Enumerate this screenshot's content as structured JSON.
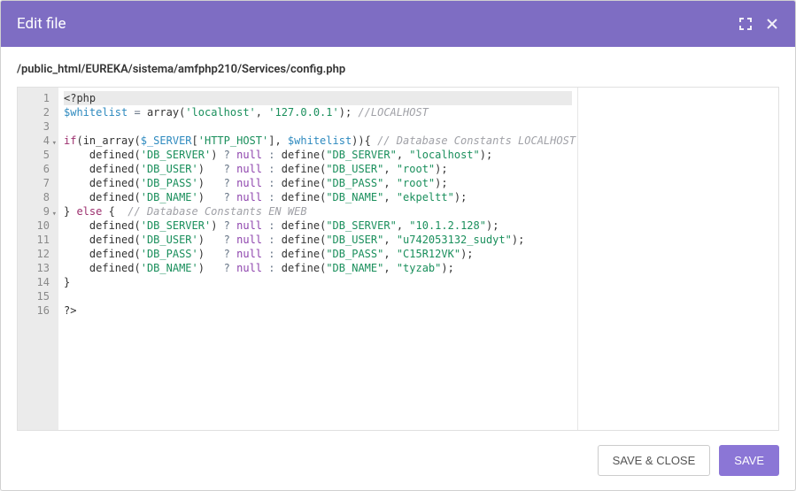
{
  "header": {
    "title": "Edit file"
  },
  "file": {
    "path": "/public_html/EUREKA/sistema/amfphp210/Services/config.php"
  },
  "code": {
    "lines": [
      [
        {
          "t": "tag",
          "v": "<?php"
        }
      ],
      [
        {
          "t": "var",
          "v": "$whitelist"
        },
        {
          "t": "txt",
          "v": " "
        },
        {
          "t": "op",
          "v": "="
        },
        {
          "t": "txt",
          "v": " "
        },
        {
          "t": "fn",
          "v": "array"
        },
        {
          "t": "txt",
          "v": "("
        },
        {
          "t": "str",
          "v": "'localhost'"
        },
        {
          "t": "txt",
          "v": ", "
        },
        {
          "t": "str",
          "v": "'127.0.0.1'"
        },
        {
          "t": "txt",
          "v": "); "
        },
        {
          "t": "cmt",
          "v": "//LOCALHOST"
        }
      ],
      [
        {
          "t": "txt",
          "v": ""
        }
      ],
      [
        {
          "t": "kw",
          "v": "if"
        },
        {
          "t": "txt",
          "v": "("
        },
        {
          "t": "fn",
          "v": "in_array"
        },
        {
          "t": "txt",
          "v": "("
        },
        {
          "t": "var",
          "v": "$_SERVER"
        },
        {
          "t": "txt",
          "v": "["
        },
        {
          "t": "str",
          "v": "'HTTP_HOST'"
        },
        {
          "t": "txt",
          "v": "], "
        },
        {
          "t": "var",
          "v": "$whitelist"
        },
        {
          "t": "txt",
          "v": ")){ "
        },
        {
          "t": "cmt",
          "v": "// Database Constants LOCALHOST"
        }
      ],
      [
        {
          "t": "txt",
          "v": "    "
        },
        {
          "t": "fn",
          "v": "defined"
        },
        {
          "t": "txt",
          "v": "("
        },
        {
          "t": "str",
          "v": "'DB_SERVER'"
        },
        {
          "t": "txt",
          "v": ") "
        },
        {
          "t": "op",
          "v": "?"
        },
        {
          "t": "txt",
          "v": " "
        },
        {
          "t": "null",
          "v": "null"
        },
        {
          "t": "txt",
          "v": " "
        },
        {
          "t": "op",
          "v": ":"
        },
        {
          "t": "txt",
          "v": " "
        },
        {
          "t": "fn",
          "v": "define"
        },
        {
          "t": "txt",
          "v": "("
        },
        {
          "t": "str",
          "v": "\"DB_SERVER\""
        },
        {
          "t": "txt",
          "v": ", "
        },
        {
          "t": "str",
          "v": "\"localhost\""
        },
        {
          "t": "txt",
          "v": ");"
        }
      ],
      [
        {
          "t": "txt",
          "v": "    "
        },
        {
          "t": "fn",
          "v": "defined"
        },
        {
          "t": "txt",
          "v": "("
        },
        {
          "t": "str",
          "v": "'DB_USER'"
        },
        {
          "t": "txt",
          "v": ")   "
        },
        {
          "t": "op",
          "v": "?"
        },
        {
          "t": "txt",
          "v": " "
        },
        {
          "t": "null",
          "v": "null"
        },
        {
          "t": "txt",
          "v": " "
        },
        {
          "t": "op",
          "v": ":"
        },
        {
          "t": "txt",
          "v": " "
        },
        {
          "t": "fn",
          "v": "define"
        },
        {
          "t": "txt",
          "v": "("
        },
        {
          "t": "str",
          "v": "\"DB_USER\""
        },
        {
          "t": "txt",
          "v": ", "
        },
        {
          "t": "str",
          "v": "\"root\""
        },
        {
          "t": "txt",
          "v": ");"
        }
      ],
      [
        {
          "t": "txt",
          "v": "    "
        },
        {
          "t": "fn",
          "v": "defined"
        },
        {
          "t": "txt",
          "v": "("
        },
        {
          "t": "str",
          "v": "'DB_PASS'"
        },
        {
          "t": "txt",
          "v": ")   "
        },
        {
          "t": "op",
          "v": "?"
        },
        {
          "t": "txt",
          "v": " "
        },
        {
          "t": "null",
          "v": "null"
        },
        {
          "t": "txt",
          "v": " "
        },
        {
          "t": "op",
          "v": ":"
        },
        {
          "t": "txt",
          "v": " "
        },
        {
          "t": "fn",
          "v": "define"
        },
        {
          "t": "txt",
          "v": "("
        },
        {
          "t": "str",
          "v": "\"DB_PASS\""
        },
        {
          "t": "txt",
          "v": ", "
        },
        {
          "t": "str",
          "v": "\"root\""
        },
        {
          "t": "txt",
          "v": ");"
        }
      ],
      [
        {
          "t": "txt",
          "v": "    "
        },
        {
          "t": "fn",
          "v": "defined"
        },
        {
          "t": "txt",
          "v": "("
        },
        {
          "t": "str",
          "v": "'DB_NAME'"
        },
        {
          "t": "txt",
          "v": ")   "
        },
        {
          "t": "op",
          "v": "?"
        },
        {
          "t": "txt",
          "v": " "
        },
        {
          "t": "null",
          "v": "null"
        },
        {
          "t": "txt",
          "v": " "
        },
        {
          "t": "op",
          "v": ":"
        },
        {
          "t": "txt",
          "v": " "
        },
        {
          "t": "fn",
          "v": "define"
        },
        {
          "t": "txt",
          "v": "("
        },
        {
          "t": "str",
          "v": "\"DB_NAME\""
        },
        {
          "t": "txt",
          "v": ", "
        },
        {
          "t": "str",
          "v": "\"ekpeltt\""
        },
        {
          "t": "txt",
          "v": ");"
        }
      ],
      [
        {
          "t": "txt",
          "v": "} "
        },
        {
          "t": "kw",
          "v": "else"
        },
        {
          "t": "txt",
          "v": " {  "
        },
        {
          "t": "cmt",
          "v": "// Database Constants EN WEB"
        }
      ],
      [
        {
          "t": "txt",
          "v": "    "
        },
        {
          "t": "fn",
          "v": "defined"
        },
        {
          "t": "txt",
          "v": "("
        },
        {
          "t": "str",
          "v": "'DB_SERVER'"
        },
        {
          "t": "txt",
          "v": ") "
        },
        {
          "t": "op",
          "v": "?"
        },
        {
          "t": "txt",
          "v": " "
        },
        {
          "t": "null",
          "v": "null"
        },
        {
          "t": "txt",
          "v": " "
        },
        {
          "t": "op",
          "v": ":"
        },
        {
          "t": "txt",
          "v": " "
        },
        {
          "t": "fn",
          "v": "define"
        },
        {
          "t": "txt",
          "v": "("
        },
        {
          "t": "str",
          "v": "\"DB_SERVER\""
        },
        {
          "t": "txt",
          "v": ", "
        },
        {
          "t": "str",
          "v": "\"10.1.2.128\""
        },
        {
          "t": "txt",
          "v": ");"
        }
      ],
      [
        {
          "t": "txt",
          "v": "    "
        },
        {
          "t": "fn",
          "v": "defined"
        },
        {
          "t": "txt",
          "v": "("
        },
        {
          "t": "str",
          "v": "'DB_USER'"
        },
        {
          "t": "txt",
          "v": ")   "
        },
        {
          "t": "op",
          "v": "?"
        },
        {
          "t": "txt",
          "v": " "
        },
        {
          "t": "null",
          "v": "null"
        },
        {
          "t": "txt",
          "v": " "
        },
        {
          "t": "op",
          "v": ":"
        },
        {
          "t": "txt",
          "v": " "
        },
        {
          "t": "fn",
          "v": "define"
        },
        {
          "t": "txt",
          "v": "("
        },
        {
          "t": "str",
          "v": "\"DB_USER\""
        },
        {
          "t": "txt",
          "v": ", "
        },
        {
          "t": "str",
          "v": "\"u742053132_sudyt\""
        },
        {
          "t": "txt",
          "v": ");"
        }
      ],
      [
        {
          "t": "txt",
          "v": "    "
        },
        {
          "t": "fn",
          "v": "defined"
        },
        {
          "t": "txt",
          "v": "("
        },
        {
          "t": "str",
          "v": "'DB_PASS'"
        },
        {
          "t": "txt",
          "v": ")   "
        },
        {
          "t": "op",
          "v": "?"
        },
        {
          "t": "txt",
          "v": " "
        },
        {
          "t": "null",
          "v": "null"
        },
        {
          "t": "txt",
          "v": " "
        },
        {
          "t": "op",
          "v": ":"
        },
        {
          "t": "txt",
          "v": " "
        },
        {
          "t": "fn",
          "v": "define"
        },
        {
          "t": "txt",
          "v": "("
        },
        {
          "t": "str",
          "v": "\"DB_PASS\""
        },
        {
          "t": "txt",
          "v": ", "
        },
        {
          "t": "str",
          "v": "\"C15R12VK\""
        },
        {
          "t": "txt",
          "v": ");"
        }
      ],
      [
        {
          "t": "txt",
          "v": "    "
        },
        {
          "t": "fn",
          "v": "defined"
        },
        {
          "t": "txt",
          "v": "("
        },
        {
          "t": "str",
          "v": "'DB_NAME'"
        },
        {
          "t": "txt",
          "v": ")   "
        },
        {
          "t": "op",
          "v": "?"
        },
        {
          "t": "txt",
          "v": " "
        },
        {
          "t": "null",
          "v": "null"
        },
        {
          "t": "txt",
          "v": " "
        },
        {
          "t": "op",
          "v": ":"
        },
        {
          "t": "txt",
          "v": " "
        },
        {
          "t": "fn",
          "v": "define"
        },
        {
          "t": "txt",
          "v": "("
        },
        {
          "t": "str",
          "v": "\"DB_NAME\""
        },
        {
          "t": "txt",
          "v": ", "
        },
        {
          "t": "str",
          "v": "\"tyzab\""
        },
        {
          "t": "txt",
          "v": ");"
        }
      ],
      [
        {
          "t": "txt",
          "v": "}"
        }
      ],
      [
        {
          "t": "txt",
          "v": ""
        }
      ],
      [
        {
          "t": "tag",
          "v": "?>"
        }
      ]
    ],
    "fold_lines": [
      4,
      9
    ],
    "active_line": 1
  },
  "footer": {
    "save_close_label": "SAVE & CLOSE",
    "save_label": "SAVE"
  }
}
